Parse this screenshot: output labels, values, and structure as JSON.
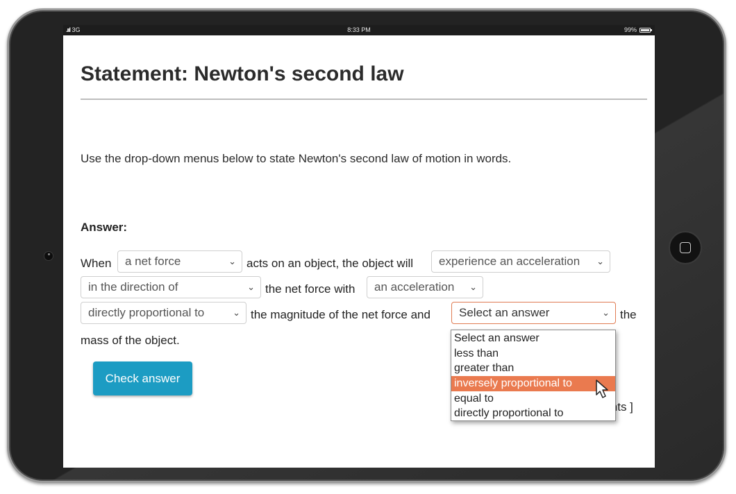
{
  "status_bar": {
    "carrier": "3G",
    "time": "8:33 PM",
    "battery": "99%"
  },
  "page": {
    "title": "Statement: Newton's second law",
    "instructions": "Use the drop-down menus below to state Newton's second law of motion in words.",
    "answer_label": "Answer:"
  },
  "sentence": {
    "part_when": "When",
    "part_acts": "acts on an object, the object will",
    "part_net_force_with": "the net force with",
    "part_magnitude": "the magnitude of the net force and",
    "part_the": "the",
    "part_mass": "mass of the object."
  },
  "selects": {
    "s1": "a net force",
    "s2": "experience an acceleration",
    "s3": "in the direction of",
    "s4": "an acceleration",
    "s5": "directly proportional to",
    "s6": "Select an answer"
  },
  "dropdown": {
    "options": [
      "Select an answer",
      "less than",
      "greater than",
      "inversely proportional to",
      "equal to",
      "directly proportional to"
    ],
    "highlighted_index": 3
  },
  "check_button_label": "Check answer",
  "points_text_visible": "ints ]",
  "colors": {
    "button": "#1c9cc3",
    "highlight": "#ea7a4f",
    "active_border": "#e07b52"
  },
  "icons": [
    "signal-icon",
    "battery-icon",
    "chevron-down-icon",
    "pointer-cursor-icon",
    "home-button-icon",
    "camera-icon"
  ]
}
